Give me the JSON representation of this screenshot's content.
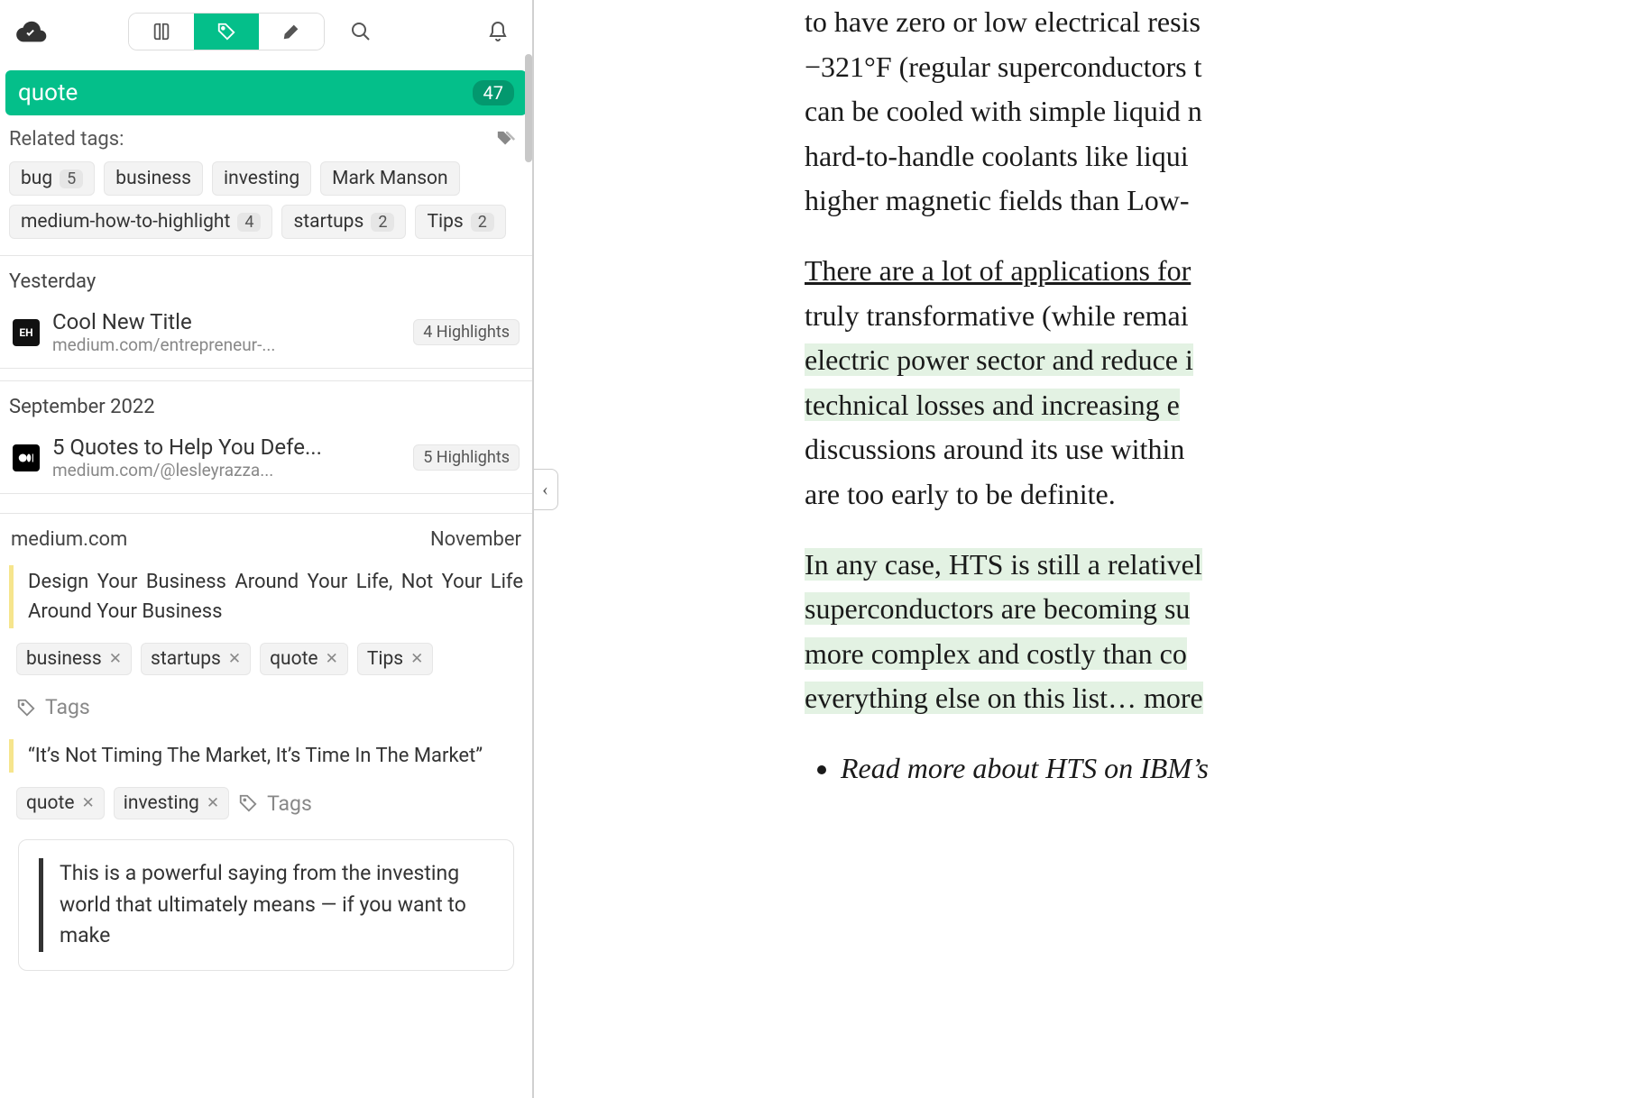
{
  "tagHeader": {
    "name": "quote",
    "count": "47"
  },
  "related": {
    "label": "Related tags:",
    "tags": [
      {
        "name": "bug",
        "count": "5"
      },
      {
        "name": "business",
        "count": ""
      },
      {
        "name": "investing",
        "count": ""
      },
      {
        "name": "Mark Manson",
        "count": ""
      },
      {
        "name": "medium-how-to-highlight",
        "count": "4"
      },
      {
        "name": "startups",
        "count": "2"
      },
      {
        "name": "Tips",
        "count": "2"
      }
    ]
  },
  "groups": [
    {
      "label": "Yesterday",
      "items": [
        {
          "icon": "EH",
          "title": "Cool New Title",
          "url": "medium.com/entrepreneur-...",
          "badge": "4 Highlights"
        }
      ]
    },
    {
      "label": "September 2022",
      "items": [
        {
          "icon": "M",
          "title": "5 Quotes to Help You Defe...",
          "url": "medium.com/@lesleyrazza...",
          "badge": "5 Highlights"
        }
      ]
    }
  ],
  "detail": {
    "source": "medium.com",
    "date": "November",
    "highlights": [
      {
        "text": "Design Your Business Around Your Life, Not Your Life Around Your Business",
        "tags": [
          "business",
          "startups",
          "quote",
          "Tips"
        ],
        "addLabel": "Tags"
      },
      {
        "text": "“It’s Not Timing The Market, It’s Time In The Market”",
        "tags": [
          "quote",
          "investing"
        ],
        "addLabel": "Tags"
      }
    ],
    "note": "This is a powerful saying from the investing world that ultimately means — if you want to make"
  },
  "reader": {
    "p1a": "to have zero or low electrical resis",
    "p1b": "−321°F (regular superconductors t",
    "p1c": "can be cooled with simple liquid n",
    "p1d": "hard-to-handle coolants like liqui",
    "p1e": "higher magnetic fields than Low-",
    "p2_link": "There are a lot of applications for ",
    "p2a": "truly transformative (while remai",
    "p2b": "electric power sector and reduce i",
    "p2c": "technical losses and increasing e",
    "p2d": "discussions around its use within ",
    "p2e": "are too early to be definite.",
    "p3a": "In any case, HTS is still a relativel",
    "p3b": "superconductors are becoming su",
    "p3c": "more complex and costly than co",
    "p3d": "everything else on this list… more",
    "li1": "Read more about HTS on IBM’s"
  }
}
